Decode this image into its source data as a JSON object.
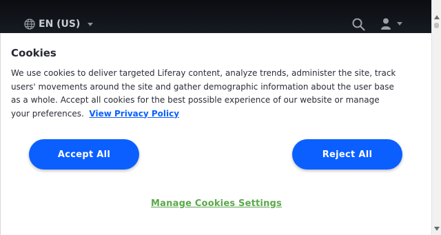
{
  "header": {
    "language_label": "EN (US)",
    "icons": [
      "globe-icon",
      "chevron-down-icon",
      "search-icon",
      "user-icon"
    ]
  },
  "cookie_banner": {
    "title": "Cookies",
    "description": "We use cookies to deliver targeted Liferay content, analyze trends, administer the site, track users' movements around the site and gather demographic information about the user base as a whole. Accept all cookies for the best possible experience of our website or manage your preferences.",
    "privacy_link": "View Privacy Policy",
    "accept_label": "Accept All",
    "reject_label": "Reject All",
    "manage_label": "Manage Cookies Settings"
  },
  "colors": {
    "topbar": "#0b0d12",
    "primary_button": "#0b5fff",
    "link": "#0b5fff",
    "manage_link": "#5aa84a"
  }
}
